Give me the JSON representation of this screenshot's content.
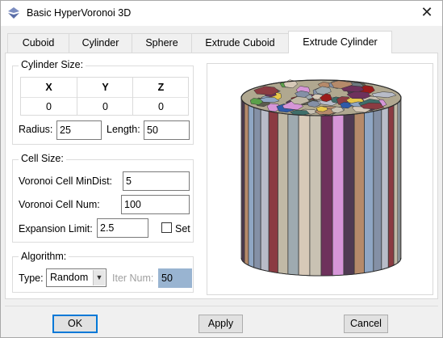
{
  "window": {
    "title": "Basic HyperVoronoi 3D",
    "close_glyph": "✕",
    "icon": "hypervoronoi-app-icon"
  },
  "tabs": [
    {
      "label": "Cuboid"
    },
    {
      "label": "Cylinder"
    },
    {
      "label": "Sphere"
    },
    {
      "label": "Extrude Cuboid"
    },
    {
      "label": "Extrude Cylinder",
      "active": true
    }
  ],
  "cylinder_size": {
    "group_label": "Cylinder Size:",
    "headers": [
      "X",
      "Y",
      "Z"
    ],
    "values": [
      "0",
      "0",
      "0"
    ],
    "radius_label": "Radius:",
    "radius_value": "25",
    "length_label": "Length:",
    "length_value": "50"
  },
  "cell_size": {
    "group_label": "Cell Size:",
    "mindist_label": "Voronoi Cell MinDist:",
    "mindist_value": "5",
    "num_label": "Voronoi Cell Num:",
    "num_value": "100",
    "expansion_label": "Expansion Limit:",
    "expansion_value": "2.5",
    "set_label": "Set",
    "set_checked": false
  },
  "algorithm": {
    "group_label": "Algorithm:",
    "type_label": "Type:",
    "type_value": "Random",
    "iter_label": "Iter Num:",
    "iter_value": "50"
  },
  "preview": {
    "palette": [
      "#8fa6c4",
      "#c9c2b3",
      "#b8bcc8",
      "#d696d8",
      "#c1b9a6",
      "#b58a6a",
      "#d7c9b8",
      "#8490a6",
      "#6e315c",
      "#8b3b42",
      "#4f3a52",
      "#9eaab0",
      "#6d7a80",
      "#a08a7a",
      "#5b5b4d",
      "#3e6e6a",
      "#e8c84a",
      "#2e5aa8",
      "#9b1b1b",
      "#5aa04a"
    ]
  },
  "buttons": {
    "ok": "OK",
    "apply": "Apply",
    "cancel": "Cancel"
  },
  "colors": {
    "accent": "#0078d7",
    "selection": "#99b4d1"
  }
}
